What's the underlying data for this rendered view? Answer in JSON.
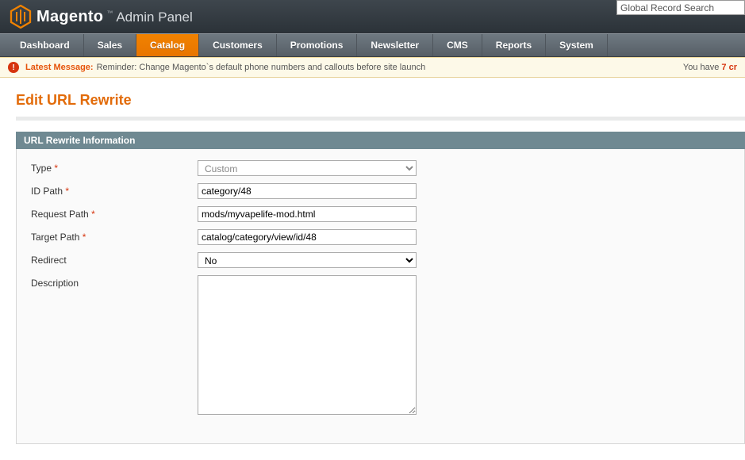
{
  "header": {
    "brand_main": "Magento",
    "brand_tm": "™",
    "brand_sub": "Admin Panel",
    "search_value": "Global Record Search"
  },
  "nav": {
    "items": [
      {
        "label": "Dashboard",
        "active": false
      },
      {
        "label": "Sales",
        "active": false
      },
      {
        "label": "Catalog",
        "active": true
      },
      {
        "label": "Customers",
        "active": false
      },
      {
        "label": "Promotions",
        "active": false
      },
      {
        "label": "Newsletter",
        "active": false
      },
      {
        "label": "CMS",
        "active": false
      },
      {
        "label": "Reports",
        "active": false
      },
      {
        "label": "System",
        "active": false
      }
    ]
  },
  "message": {
    "label": "Latest Message:",
    "text": "Reminder: Change Magento`s default phone numbers and callouts before site launch",
    "right_prefix": "You have ",
    "right_count": "7 cr"
  },
  "page": {
    "title": "Edit URL Rewrite",
    "section_title": "URL Rewrite Information"
  },
  "form": {
    "type_label": "Type",
    "type_value": "Custom",
    "id_path_label": "ID Path",
    "id_path_value": "category/48",
    "request_path_label": "Request Path",
    "request_path_value": "mods/myvapelife-mod.html",
    "target_path_label": "Target Path",
    "target_path_value": "catalog/category/view/id/48",
    "redirect_label": "Redirect",
    "redirect_value": "No",
    "description_label": "Description",
    "description_value": ""
  }
}
